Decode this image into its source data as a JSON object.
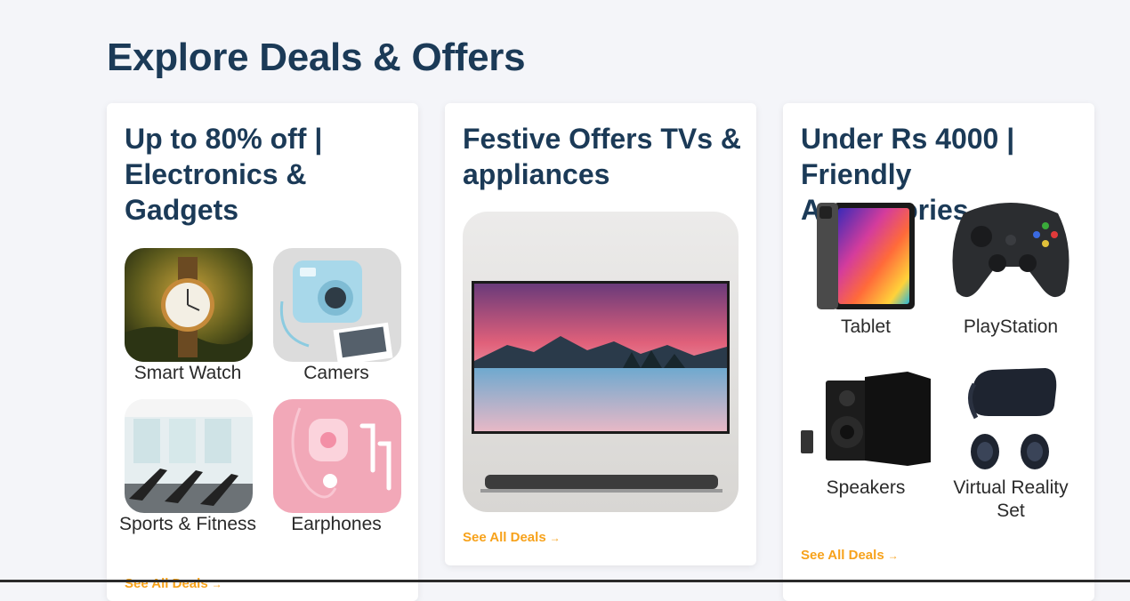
{
  "page": {
    "title": "Explore Deals & Offers"
  },
  "cards": [
    {
      "title": "Up to 80% off | Electronics & Gadgets",
      "items": [
        {
          "label": "Smart Watch"
        },
        {
          "label": "Camers"
        },
        {
          "label": "Sports & Fitness"
        },
        {
          "label": "Earphones"
        }
      ],
      "see_all": "See All Deals"
    },
    {
      "title": "Festive Offers TVs & appliances",
      "see_all": "See All Deals"
    },
    {
      "title": "Under Rs 4000 | Friendly Accessories",
      "items": [
        {
          "label": "Tablet"
        },
        {
          "label": "PlayStation"
        },
        {
          "label": "Speakers"
        },
        {
          "label": "Virtual Reality Set"
        }
      ],
      "see_all": "See All Deals"
    }
  ],
  "colors": {
    "heading": "#1b3a57",
    "link": "#f7a21b",
    "background": "#f4f5f9"
  },
  "icons": {
    "see_all_arrow": "arrow-right-icon"
  }
}
